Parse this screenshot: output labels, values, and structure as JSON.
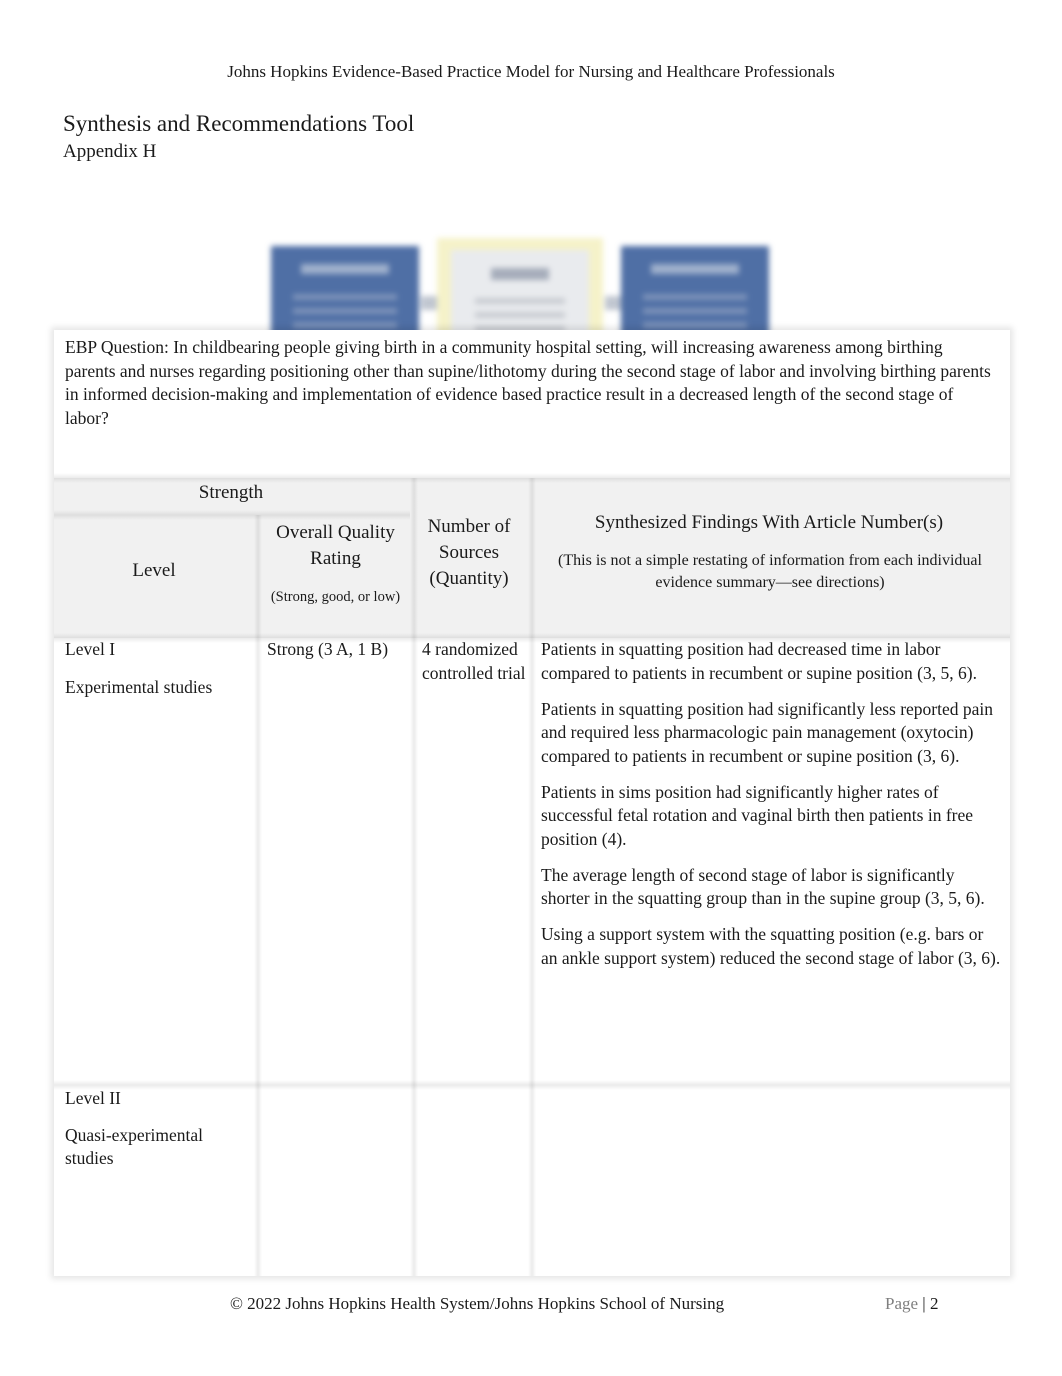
{
  "header": {
    "running_title": "Johns Hopkins Evidence-Based Practice Model for Nursing and Healthcare Professionals",
    "title": "Synthesis and Recommendations Tool",
    "subtitle": "Appendix H"
  },
  "diagram": {
    "description": "blurred process diagram with three boxes",
    "colors": {
      "box": "#4f6fa5",
      "highlight": "#f5f2c9"
    }
  },
  "ebp_question": "EBP Question: In childbearing people giving birth in a community hospital setting, will increasing awareness among birthing parents and nurses regarding positioning other than supine/lithotomy during the second stage of labor and involving birthing parents in informed decision-making and implementation of evidence based practice result in a decreased length of the second stage of labor?",
  "table": {
    "headers": {
      "strength": "Strength",
      "level": "Level",
      "quality": "Overall Quality Rating",
      "quality_note": "(Strong, good, or low)",
      "sources": "Number of Sources (Quantity)",
      "findings": "Synthesized Findings With Article Number(s)",
      "findings_note": "(This is not a simple restating of information from each individual evidence summary—see directions)"
    },
    "rows": [
      {
        "level": "Level I",
        "level_desc": "Experimental studies",
        "quality": "Strong (3 A, 1 B)",
        "sources": "4 randomized controlled trial",
        "findings": [
          "Patients in squatting position had decreased time in labor compared to patients in recumbent or supine position (3, 5, 6).",
          "Patients in squatting position had significantly less reported pain and required less pharmacologic pain management (oxytocin) compared to patients in recumbent or supine position (3, 6).",
          "Patients in sims position had significantly higher rates of successful fetal rotation and vaginal birth then patients in free position (4).",
          "The average length of second stage of labor is significantly shorter in the squatting group than in the supine group (3, 5, 6).",
          "Using a support system with the squatting position (e.g. bars or an ankle support system) reduced the second stage of labor (3, 6)."
        ]
      },
      {
        "level": "Level II",
        "level_desc": "Quasi-experimental studies",
        "quality": "",
        "sources": "",
        "findings": []
      }
    ]
  },
  "footer": {
    "copyright": "© 2022 Johns Hopkins Health System/Johns Hopkins School of Nursing",
    "page_label": "Page",
    "separator": "|",
    "page_number": "2"
  }
}
